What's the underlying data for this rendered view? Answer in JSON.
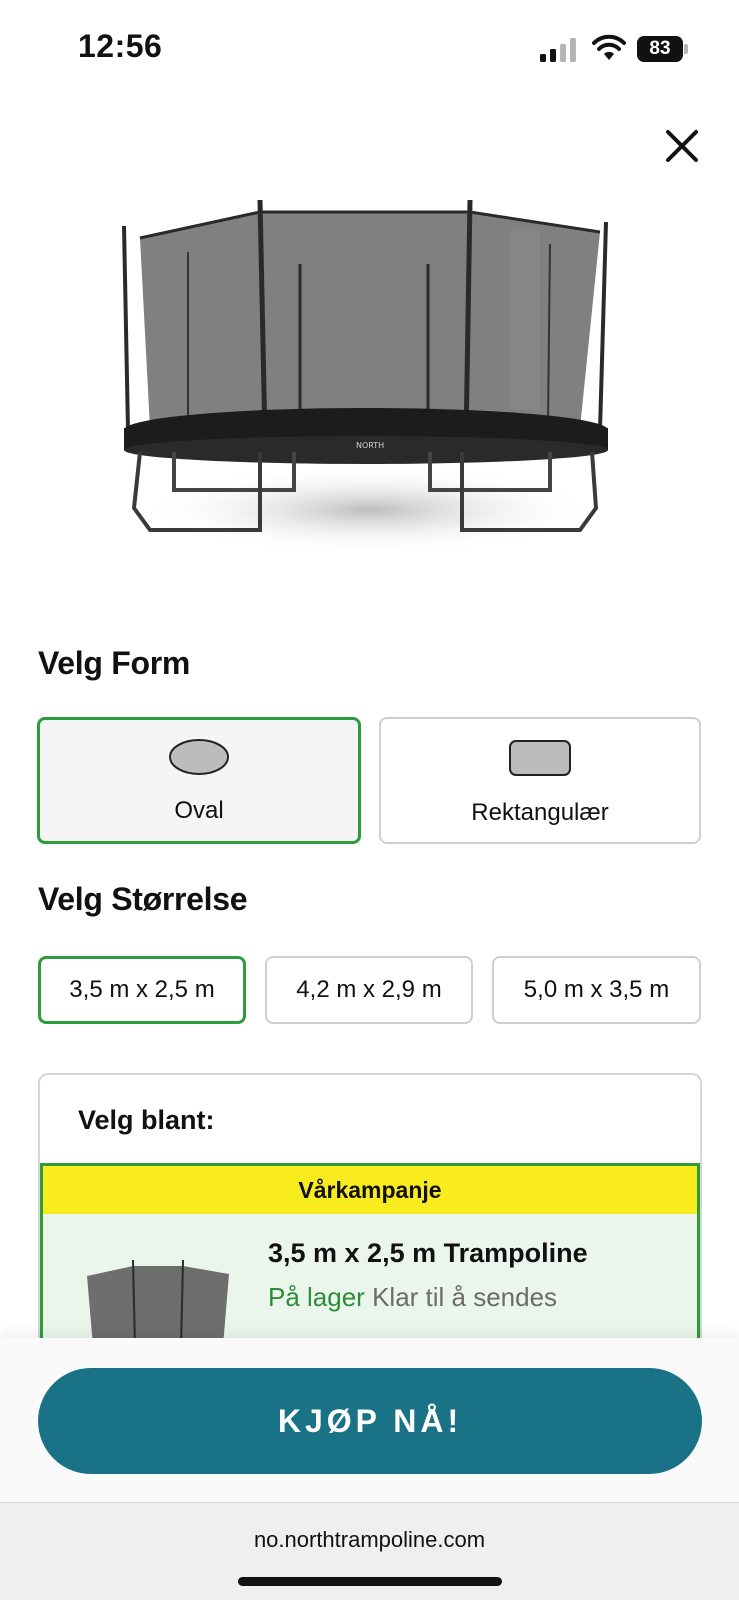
{
  "status_bar": {
    "time": "12:56",
    "battery": "83"
  },
  "sections": {
    "shape_title": "Velg Form",
    "size_title": "Velg Størrelse"
  },
  "shapes": [
    {
      "label": "Oval",
      "selected": true
    },
    {
      "label": "Rektangulær",
      "selected": false
    }
  ],
  "sizes": [
    {
      "label": "3,5 m x 2,5 m",
      "selected": true
    },
    {
      "label": "4,2 m x 2,9 m",
      "selected": false
    },
    {
      "label": "5,0 m x 3,5 m",
      "selected": false
    }
  ],
  "choose": {
    "title": "Velg blant:",
    "offer": {
      "banner": "Vårkampanje",
      "name": "3,5 m x 2,5 m Trampoline",
      "stock_status": "På lager",
      "stock_note": "Klar til å sendes"
    }
  },
  "buy_button": "KJØP NÅ!",
  "url": "no.northtrampoline.com",
  "colors": {
    "accent_green": "#2e9c3c",
    "button_teal": "#1a7287",
    "banner_yellow": "#f8ec1e"
  },
  "icons": [
    "signal-icon",
    "wifi-icon",
    "battery-icon",
    "close-icon",
    "oval-shape-icon",
    "rectangle-shape-icon"
  ]
}
